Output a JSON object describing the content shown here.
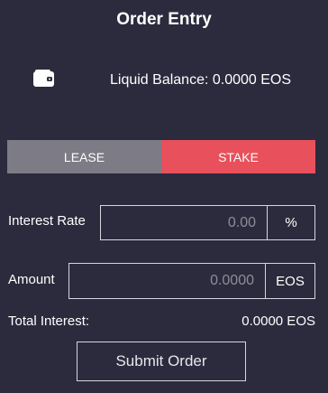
{
  "title": "Order Entry",
  "balance": {
    "icon": "wallet-icon",
    "label": "Liquid Balance: 0.0000 EOS"
  },
  "tabs": [
    {
      "label": "LEASE",
      "active": false,
      "color": "#7c7b86"
    },
    {
      "label": "STAKE",
      "active": true,
      "color": "#e8505b"
    }
  ],
  "interest_rate": {
    "label": "Interest Rate",
    "placeholder": "0.00",
    "unit": "%"
  },
  "amount": {
    "label": "Amount",
    "placeholder": "0.0000",
    "unit": "EOS"
  },
  "total_interest": {
    "label": "Total Interest:",
    "value": "0.0000 EOS"
  },
  "submit_label": "Submit Order",
  "colors": {
    "background": "#2b2b3d",
    "accent": "#e8505b"
  }
}
